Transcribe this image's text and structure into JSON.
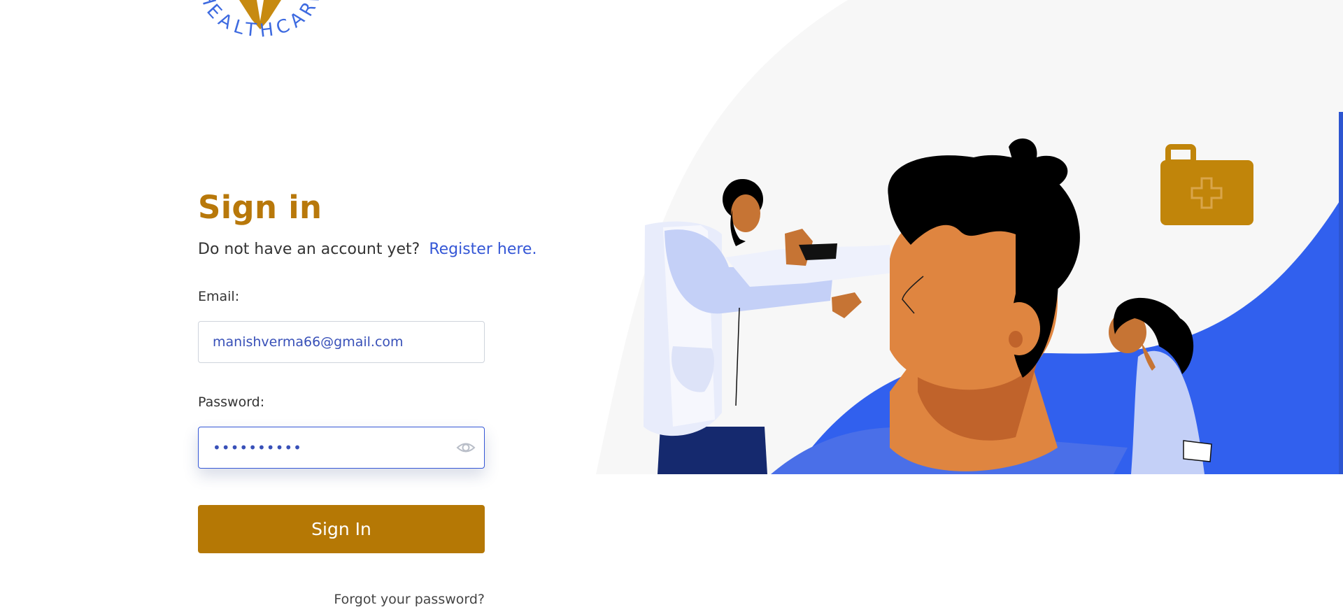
{
  "brand": {
    "logo_text": "HEALTHCARE"
  },
  "signin": {
    "title": "Sign in",
    "prompt": "Do not have an account yet?",
    "register_link": "Register here.",
    "email_label": "Email:",
    "email_value": "manishverma66@gmail.com",
    "password_label": "Password:",
    "password_value": "••••••••••",
    "submit_label": "Sign In",
    "forgot_link": "Forgot your password?"
  },
  "icons": {
    "show_password": "eye-icon",
    "first_aid": "first-aid-kit-icon"
  },
  "colors": {
    "accent_gold": "#b57805",
    "title_gold": "#b8780a",
    "link_blue": "#3557d6",
    "hero_blue": "#3160ee"
  }
}
